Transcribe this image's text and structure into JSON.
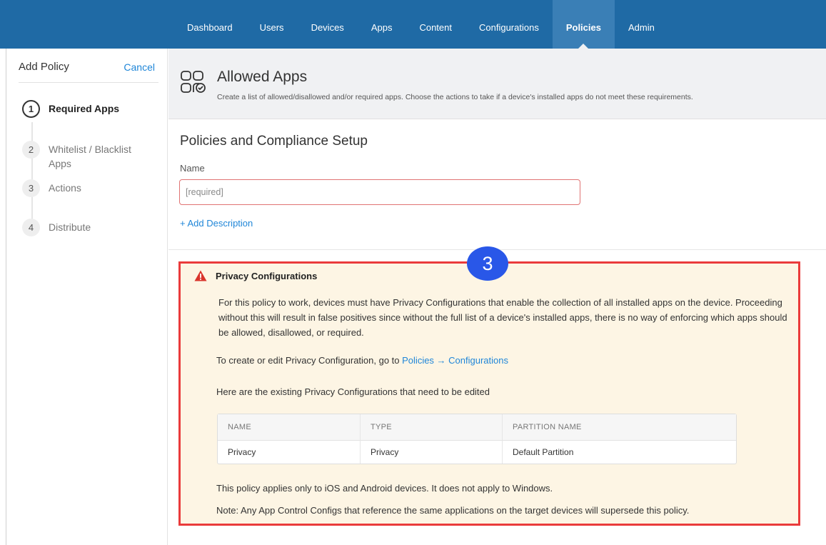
{
  "nav": {
    "items": [
      {
        "label": "Dashboard"
      },
      {
        "label": "Users"
      },
      {
        "label": "Devices"
      },
      {
        "label": "Apps"
      },
      {
        "label": "Content"
      },
      {
        "label": "Configurations"
      },
      {
        "label": "Policies",
        "active": true
      },
      {
        "label": "Admin"
      }
    ]
  },
  "sidebar": {
    "title": "Add Policy",
    "cancel": "Cancel",
    "steps": [
      {
        "number": "1",
        "label": "Required Apps",
        "active": true
      },
      {
        "number": "2",
        "label": "Whitelist / Blacklist Apps"
      },
      {
        "number": "3",
        "label": "Actions"
      },
      {
        "number": "4",
        "label": "Distribute"
      }
    ]
  },
  "header": {
    "icon": "apps-grid-check-icon",
    "title": "Allowed Apps",
    "description": "Create a list of allowed/disallowed and/or required apps. Choose the actions to take if a device's installed apps do not meet these requirements."
  },
  "setup": {
    "title": "Policies and Compliance Setup",
    "name_label": "Name",
    "name_value": "",
    "name_placeholder": "[required]",
    "add_description": "+ Add Description"
  },
  "alert": {
    "badge": "3",
    "icon": "warning-triangle-icon",
    "title": "Privacy Configurations",
    "body": "For this policy to work, devices must have Privacy Configurations that enable the collection of all installed apps on the device. Proceeding without this will result in false positives since without the full list of a device's installed apps, there is no way of enforcing which apps should be allowed, disallowed, or required.",
    "create_prefix": "To create or edit Privacy Configuration, go to ",
    "create_link": "Policies → Configurations",
    "existing_text": "Here are the existing Privacy Configurations that need to be edited",
    "table": {
      "columns": [
        "NAME",
        "TYPE",
        "PARTITION NAME"
      ],
      "rows": [
        [
          "Privacy",
          "Privacy",
          "Default Partition"
        ]
      ]
    },
    "applies_text": "This policy applies only to iOS and Android devices. It does not apply to Windows.",
    "note_text": "Note: Any App Control Configs that reference the same applications on the target devices will supersede this policy."
  },
  "colors": {
    "nav_bg": "#1f6aa5",
    "nav_active": "#3a7fb6",
    "link": "#1f86d8",
    "alert_bg": "#fdf5e4",
    "alert_border": "#ea3b3b",
    "badge": "#2957e8",
    "warning": "#d9342b"
  }
}
